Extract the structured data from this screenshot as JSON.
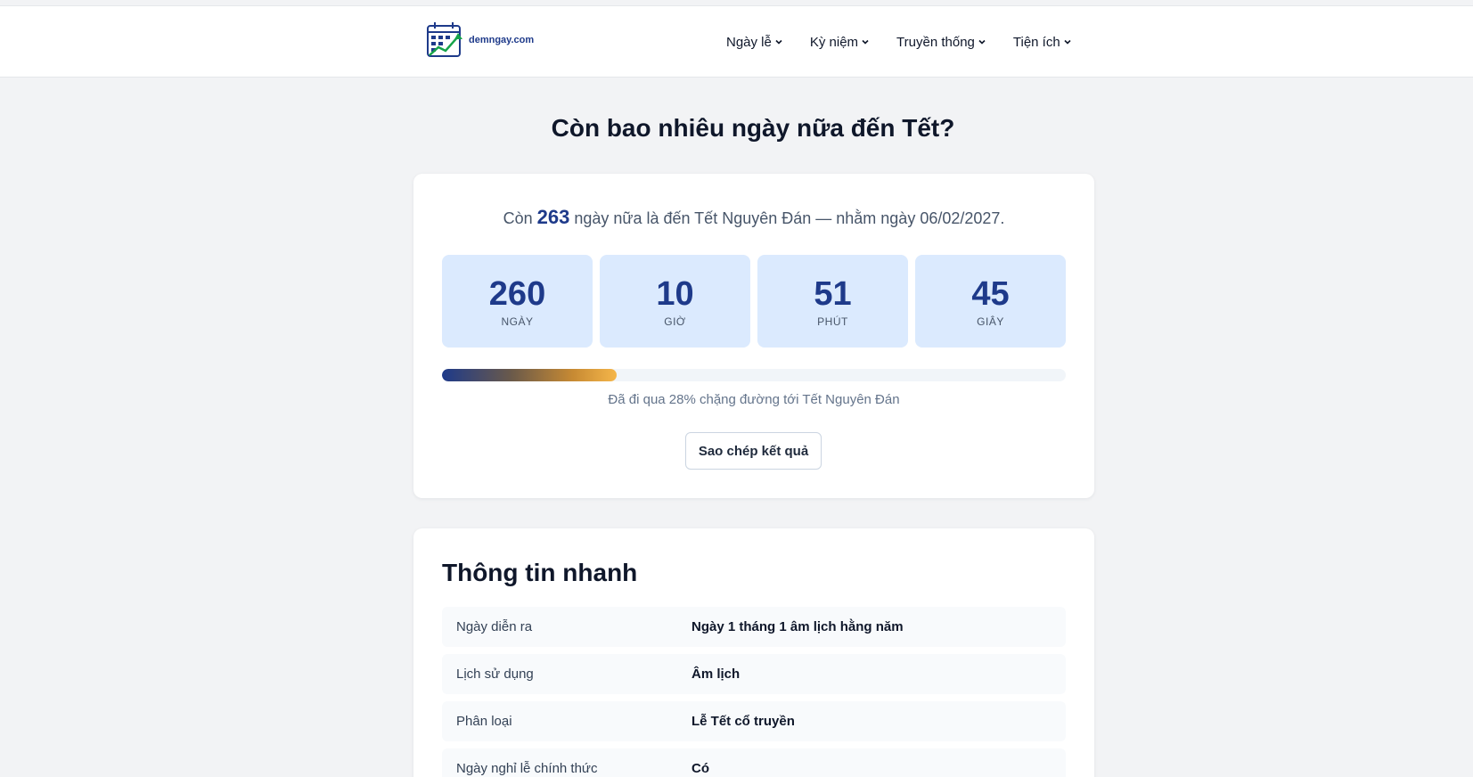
{
  "header": {
    "logo_text": "demngay.com",
    "nav": [
      {
        "label": "Ngày lễ"
      },
      {
        "label": "Kỳ niệm"
      },
      {
        "label": "Truyền thống"
      },
      {
        "label": "Tiện ích"
      }
    ]
  },
  "page": {
    "title": "Còn bao nhiêu ngày nữa đến Tết?"
  },
  "countdown": {
    "summary_prefix": "Còn",
    "summary_days": "263",
    "summary_suffix": "ngày nữa là đến Tết Nguyên Đán — nhằm ngày 06/02/2027.",
    "boxes": [
      {
        "value": "260",
        "label": "NGÀY"
      },
      {
        "value": "10",
        "label": "GIỜ"
      },
      {
        "value": "51",
        "label": "PHÚT"
      },
      {
        "value": "45",
        "label": "GIÂY"
      }
    ],
    "progress_percent": 28,
    "progress_text": "Đã đi qua 28% chặng đường tới Tết Nguyên Đán",
    "copy_button": "Sao chép kết quả"
  },
  "quick_info": {
    "title": "Thông tin nhanh",
    "rows": [
      {
        "key": "Ngày diễn ra",
        "value": "Ngày 1 tháng 1 âm lịch hằng năm"
      },
      {
        "key": "Lịch sử dụng",
        "value": "Âm lịch"
      },
      {
        "key": "Phân loại",
        "value": "Lễ Tết cổ truyền"
      },
      {
        "key": "Ngày nghỉ lễ chính thức",
        "value": "Có"
      }
    ]
  },
  "colors": {
    "primary": "#1e3a8a",
    "box_bg": "#dbeafe",
    "accent": "#f5b64a",
    "page_bg": "#f2f3f5"
  }
}
